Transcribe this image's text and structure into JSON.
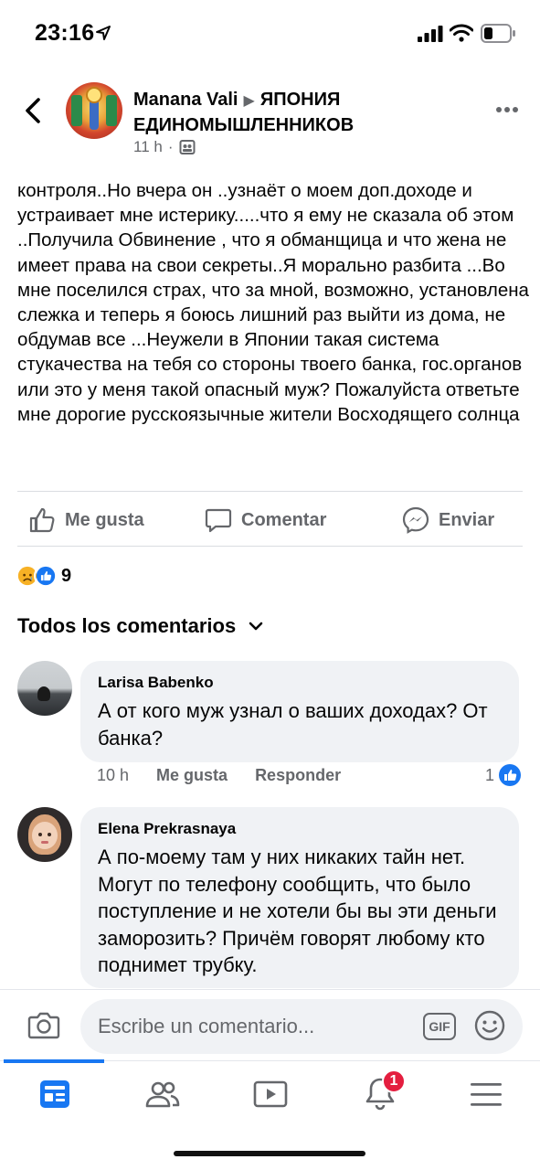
{
  "status_bar": {
    "time": "23:16"
  },
  "post": {
    "author": "Manana Vali",
    "group": "ЯПОНИЯ ЕДИНОМЫШЛЕННИКОВ",
    "age": "11 h",
    "body": "контроля..Но вчера он ..узнаёт о моем доп.доходе и устраивает мне истерику.....что я ему не сказала об этом ..Получила Обвинение , что я обманщица и что жена не имеет права на свои секреты..Я морально разбита ...Во мне поселился страх, что за мной, возможно, установлена слежка и теперь я боюсь лишний раз выйти из дома, не обдумав все ...Неужели в Японии такая система стукачества на тебя со стороны твоего банка, гос.органов или это у меня такой опасный муж? Пожалуйста ответьте мне дорогие русскоязычные жители Восходящего солнца"
  },
  "actions": {
    "like": "Me gusta",
    "comment": "Comentar",
    "send": "Enviar"
  },
  "reactions": {
    "count": "9"
  },
  "comments_heading": "Todos los comentarios",
  "comments": [
    {
      "name": "Larisa Babenko",
      "text": "А от кого муж узнал о ваших доходах? От банка?",
      "time": "10 h",
      "like_label": "Me gusta",
      "reply_label": "Responder",
      "likes": "1"
    },
    {
      "name": "Elena Prekrasnaya",
      "text": "А по-моему там у них никаких тайн нет. Могут по телефону сообщить, что было поступление и не хотели бы вы эти деньги заморозить? Причём говорят любому кто поднимет трубку."
    }
  ],
  "input": {
    "placeholder": "Escribe un comentario...",
    "gif_label": "GIF"
  },
  "tab_bar": {
    "notifications_badge": "1"
  },
  "colors": {
    "accent": "#1877f2",
    "badge": "#e41e3f",
    "bubble": "#f0f2f5",
    "muted": "#65676b"
  }
}
